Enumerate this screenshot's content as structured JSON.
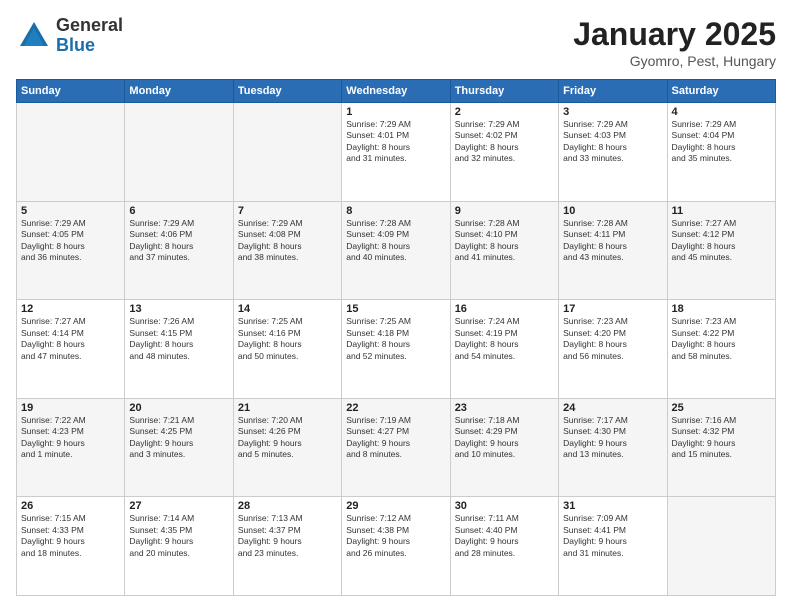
{
  "logo": {
    "general": "General",
    "blue": "Blue"
  },
  "header": {
    "title": "January 2025",
    "location": "Gyomro, Pest, Hungary"
  },
  "weekdays": [
    "Sunday",
    "Monday",
    "Tuesday",
    "Wednesday",
    "Thursday",
    "Friday",
    "Saturday"
  ],
  "weeks": [
    [
      {
        "day": "",
        "info": ""
      },
      {
        "day": "",
        "info": ""
      },
      {
        "day": "",
        "info": ""
      },
      {
        "day": "1",
        "info": "Sunrise: 7:29 AM\nSunset: 4:01 PM\nDaylight: 8 hours\nand 31 minutes."
      },
      {
        "day": "2",
        "info": "Sunrise: 7:29 AM\nSunset: 4:02 PM\nDaylight: 8 hours\nand 32 minutes."
      },
      {
        "day": "3",
        "info": "Sunrise: 7:29 AM\nSunset: 4:03 PM\nDaylight: 8 hours\nand 33 minutes."
      },
      {
        "day": "4",
        "info": "Sunrise: 7:29 AM\nSunset: 4:04 PM\nDaylight: 8 hours\nand 35 minutes."
      }
    ],
    [
      {
        "day": "5",
        "info": "Sunrise: 7:29 AM\nSunset: 4:05 PM\nDaylight: 8 hours\nand 36 minutes."
      },
      {
        "day": "6",
        "info": "Sunrise: 7:29 AM\nSunset: 4:06 PM\nDaylight: 8 hours\nand 37 minutes."
      },
      {
        "day": "7",
        "info": "Sunrise: 7:29 AM\nSunset: 4:08 PM\nDaylight: 8 hours\nand 38 minutes."
      },
      {
        "day": "8",
        "info": "Sunrise: 7:28 AM\nSunset: 4:09 PM\nDaylight: 8 hours\nand 40 minutes."
      },
      {
        "day": "9",
        "info": "Sunrise: 7:28 AM\nSunset: 4:10 PM\nDaylight: 8 hours\nand 41 minutes."
      },
      {
        "day": "10",
        "info": "Sunrise: 7:28 AM\nSunset: 4:11 PM\nDaylight: 8 hours\nand 43 minutes."
      },
      {
        "day": "11",
        "info": "Sunrise: 7:27 AM\nSunset: 4:12 PM\nDaylight: 8 hours\nand 45 minutes."
      }
    ],
    [
      {
        "day": "12",
        "info": "Sunrise: 7:27 AM\nSunset: 4:14 PM\nDaylight: 8 hours\nand 47 minutes."
      },
      {
        "day": "13",
        "info": "Sunrise: 7:26 AM\nSunset: 4:15 PM\nDaylight: 8 hours\nand 48 minutes."
      },
      {
        "day": "14",
        "info": "Sunrise: 7:25 AM\nSunset: 4:16 PM\nDaylight: 8 hours\nand 50 minutes."
      },
      {
        "day": "15",
        "info": "Sunrise: 7:25 AM\nSunset: 4:18 PM\nDaylight: 8 hours\nand 52 minutes."
      },
      {
        "day": "16",
        "info": "Sunrise: 7:24 AM\nSunset: 4:19 PM\nDaylight: 8 hours\nand 54 minutes."
      },
      {
        "day": "17",
        "info": "Sunrise: 7:23 AM\nSunset: 4:20 PM\nDaylight: 8 hours\nand 56 minutes."
      },
      {
        "day": "18",
        "info": "Sunrise: 7:23 AM\nSunset: 4:22 PM\nDaylight: 8 hours\nand 58 minutes."
      }
    ],
    [
      {
        "day": "19",
        "info": "Sunrise: 7:22 AM\nSunset: 4:23 PM\nDaylight: 9 hours\nand 1 minute."
      },
      {
        "day": "20",
        "info": "Sunrise: 7:21 AM\nSunset: 4:25 PM\nDaylight: 9 hours\nand 3 minutes."
      },
      {
        "day": "21",
        "info": "Sunrise: 7:20 AM\nSunset: 4:26 PM\nDaylight: 9 hours\nand 5 minutes."
      },
      {
        "day": "22",
        "info": "Sunrise: 7:19 AM\nSunset: 4:27 PM\nDaylight: 9 hours\nand 8 minutes."
      },
      {
        "day": "23",
        "info": "Sunrise: 7:18 AM\nSunset: 4:29 PM\nDaylight: 9 hours\nand 10 minutes."
      },
      {
        "day": "24",
        "info": "Sunrise: 7:17 AM\nSunset: 4:30 PM\nDaylight: 9 hours\nand 13 minutes."
      },
      {
        "day": "25",
        "info": "Sunrise: 7:16 AM\nSunset: 4:32 PM\nDaylight: 9 hours\nand 15 minutes."
      }
    ],
    [
      {
        "day": "26",
        "info": "Sunrise: 7:15 AM\nSunset: 4:33 PM\nDaylight: 9 hours\nand 18 minutes."
      },
      {
        "day": "27",
        "info": "Sunrise: 7:14 AM\nSunset: 4:35 PM\nDaylight: 9 hours\nand 20 minutes."
      },
      {
        "day": "28",
        "info": "Sunrise: 7:13 AM\nSunset: 4:37 PM\nDaylight: 9 hours\nand 23 minutes."
      },
      {
        "day": "29",
        "info": "Sunrise: 7:12 AM\nSunset: 4:38 PM\nDaylight: 9 hours\nand 26 minutes."
      },
      {
        "day": "30",
        "info": "Sunrise: 7:11 AM\nSunset: 4:40 PM\nDaylight: 9 hours\nand 28 minutes."
      },
      {
        "day": "31",
        "info": "Sunrise: 7:09 AM\nSunset: 4:41 PM\nDaylight: 9 hours\nand 31 minutes."
      },
      {
        "day": "",
        "info": ""
      }
    ]
  ]
}
